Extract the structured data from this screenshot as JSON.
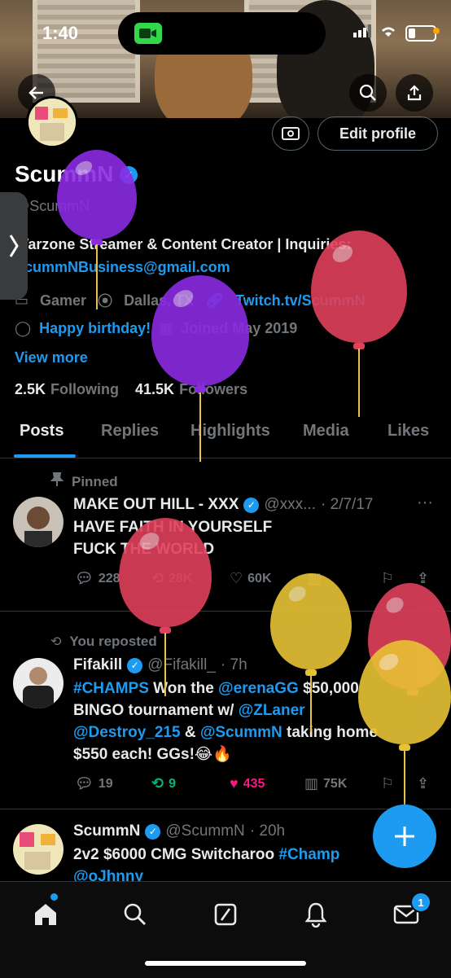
{
  "status_bar": {
    "time": "1:40"
  },
  "profile": {
    "name": "ScummN",
    "handle": "@ScummN",
    "bio_line1": "Warzone Streamer & Content Creator | Inquiries:",
    "bio_email": "ScummNBusiness@gmail.com",
    "category": "Gamer",
    "location": "Dallas, TX",
    "website": "Twitch.tv/ScummN",
    "birthday": "Happy birthday!",
    "joined": "Joined May 2019",
    "view_more": "View more",
    "following_count": "2.5K",
    "following_label": "Following",
    "followers_count": "41.5K",
    "followers_label": "Followers",
    "edit_profile_label": "Edit profile"
  },
  "tabs": [
    "Posts",
    "Replies",
    "Highlights",
    "Media",
    "Likes"
  ],
  "tweets": [
    {
      "context": "Pinned",
      "author": "MAKE OUT HILL - XXX",
      "handle": "@xxx...",
      "time": "· 2/7/17",
      "line1": "HAVE FAITH IN YOURSELF",
      "line2": "FUCK THE WORLD",
      "replies": "228",
      "reposts": "28K",
      "likes": "60K"
    },
    {
      "context": "You reposted",
      "author": "Fifakill",
      "handle": "@Fifakill_",
      "time": "· 7h",
      "hashtag": "#CHAMPS",
      "text_a": " Won the ",
      "mention1": "@erenaGG",
      "text_b": " $50,000",
      "text_c": "BINGO tournament w/ ",
      "mention2": "@ZLaner",
      "mention3": "@Destroy_215",
      "text_d": " & ",
      "mention4": "@ScummN",
      "text_e": " taking home",
      "text_f": "$550 each! GGs!😂🔥",
      "replies": "19",
      "reposts": "9",
      "likes": "435",
      "views": "75K"
    },
    {
      "author": "ScummN",
      "handle": "@ScummN",
      "time": "· 20h",
      "text": "2v2 $6000 CMG Switcharoo ",
      "hashtag": "#Champ",
      "mention": "@oJhnny"
    }
  ],
  "nav": {
    "messages_badge": "1"
  },
  "colors": {
    "accent": "#1d9bf0",
    "like": "#f91880",
    "repost": "#00ba7c",
    "background": "#000000"
  }
}
